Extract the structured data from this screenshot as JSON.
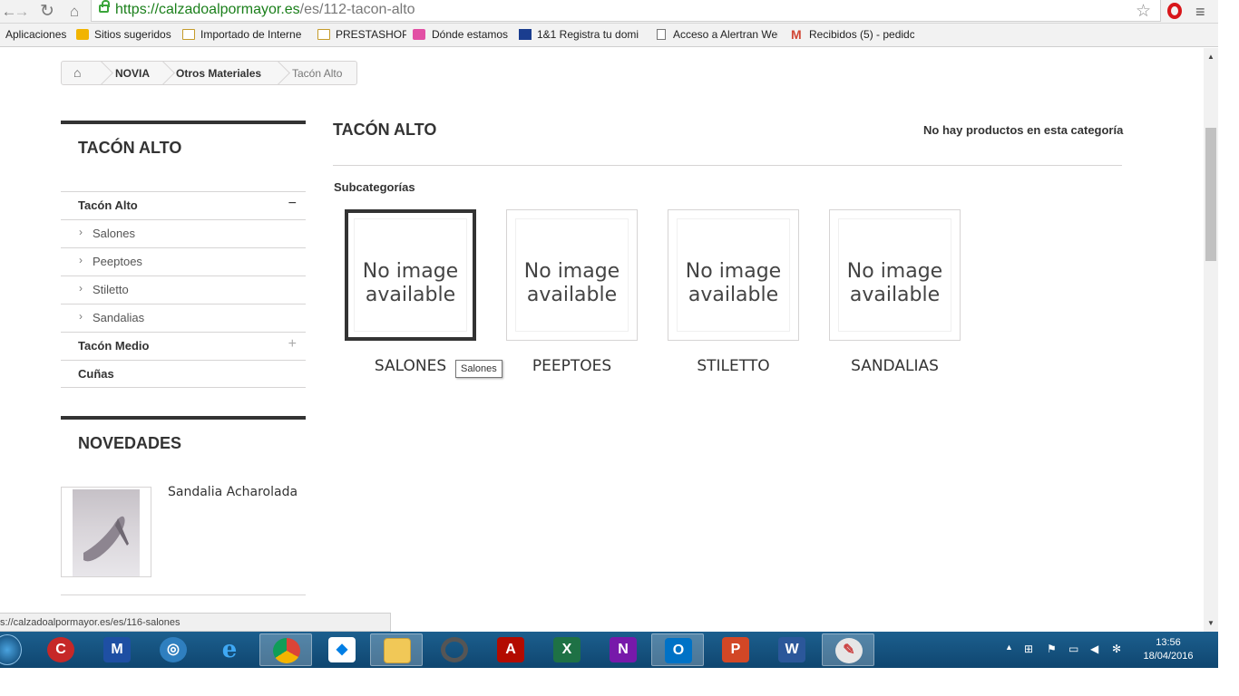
{
  "browser": {
    "url_host": "https://calzadoalpormayor.es",
    "url_path": "/es/112-tacon-alto",
    "bookmarks": [
      "Aplicaciones",
      "Sitios sugeridos",
      "Importado de Interne",
      "PRESTASHOP",
      "Dónde estamos",
      "1&1 Registra tu domi",
      "Acceso a Alertran Wel",
      "Recibidos (5) - pedidc"
    ],
    "status_url": "s://calzadoalpormayor.es/es/116-salones"
  },
  "breadcrumb": {
    "items": [
      "NOVIA",
      "Otros Materiales",
      "Tacón Alto"
    ]
  },
  "sidebar": {
    "block_title": "TACÓN ALTO",
    "tree": [
      {
        "label": "Tacón Alto",
        "toggle": "−"
      },
      {
        "label": "Salones"
      },
      {
        "label": "Peeptoes"
      },
      {
        "label": "Stiletto"
      },
      {
        "label": "Sandalias"
      },
      {
        "label": "Tacón Medio",
        "toggle": "+"
      },
      {
        "label": "Cuñas"
      }
    ],
    "new_title": "NOVEDADES",
    "new_product": "Sandalia Acharolada"
  },
  "main": {
    "title": "TACÓN ALTO",
    "heading_counter": "No hay productos en esta categoría",
    "subcategories_title": "Subcategorías",
    "no_image_text": "No image available",
    "subcategories": [
      "SALONES",
      "PEEPTOES",
      "STILETTO",
      "SANDALIAS"
    ],
    "tooltip": "Salones"
  },
  "taskbar": {
    "time": "13:56",
    "date": "18/04/2016",
    "apps": [
      "CCleaner",
      "Malwarebytes",
      "Security",
      "Internet Explorer",
      "Chrome",
      "Dropbox",
      "Explorer",
      "Camtasia",
      "Acrobat",
      "Excel",
      "OneNote",
      "Outlook",
      "PowerPoint",
      "Word",
      "Paint"
    ]
  },
  "colors": {
    "accent": "#333333",
    "secure": "#1a7f1a",
    "taskbar": "#1c5f8e"
  }
}
